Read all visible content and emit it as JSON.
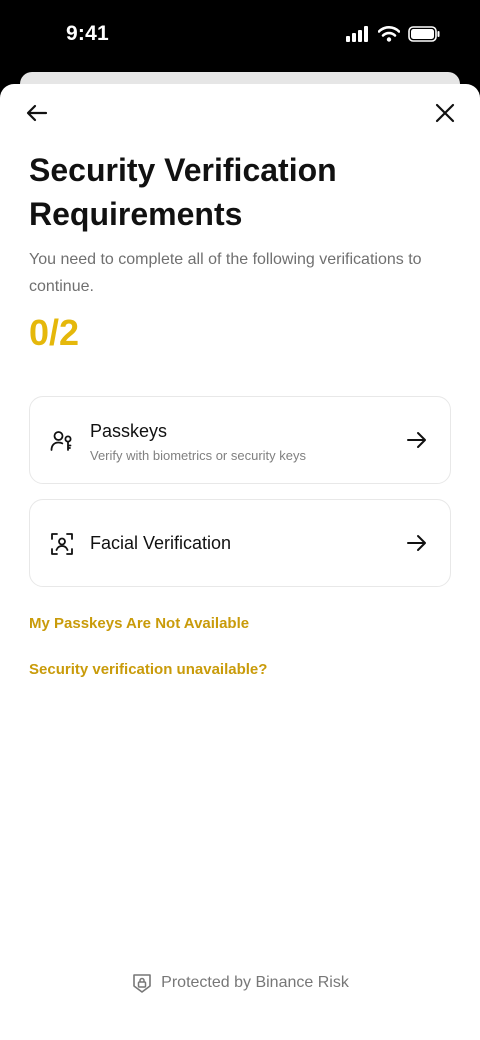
{
  "status_bar": {
    "time": "9:41"
  },
  "header": {
    "title": "Security Verification Requirements"
  },
  "intro": {
    "subtitle": "You need to complete all of the following verifications to continue.",
    "progress": "0/2"
  },
  "methods": [
    {
      "title": "Passkeys",
      "subtitle": "Verify with biometrics or security keys",
      "icon": "user-key-icon"
    },
    {
      "title": "Facial Verification",
      "subtitle": "",
      "icon": "face-scan-icon"
    }
  ],
  "links": {
    "passkeys_unavailable": "My Passkeys Are Not Available",
    "verification_unavailable": "Security verification unavailable?"
  },
  "footer": {
    "text": "Protected by Binance Risk"
  },
  "colors": {
    "accent": "#E5B80B",
    "link": "#C99B0A"
  }
}
